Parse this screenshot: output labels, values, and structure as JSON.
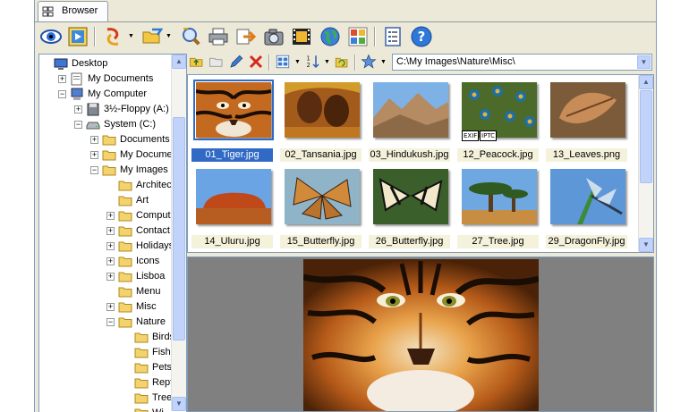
{
  "tab": {
    "label": "Browser"
  },
  "toolbar": {
    "buttons": [
      "view-icon",
      "slideshow-icon",
      "rotate-icon",
      "open-folder-icon",
      "find-icon",
      "print-icon",
      "send-icon",
      "camera-icon",
      "filmstrip-icon",
      "web-icon",
      "contact-sheet-icon",
      "properties-icon",
      "help-icon"
    ]
  },
  "tree": {
    "items": [
      {
        "label": "Desktop",
        "level": 0,
        "expander": "",
        "icon": "desktop"
      },
      {
        "label": "My Documents",
        "level": 1,
        "expander": "+",
        "icon": "documents"
      },
      {
        "label": "My Computer",
        "level": 1,
        "expander": "-",
        "icon": "computer"
      },
      {
        "label": "3½-Floppy (A:)",
        "level": 2,
        "expander": "+",
        "icon": "floppy"
      },
      {
        "label": "System (C:)",
        "level": 2,
        "expander": "-",
        "icon": "drive"
      },
      {
        "label": "Documents a",
        "level": 3,
        "expander": "+",
        "icon": "folder"
      },
      {
        "label": "My Documen",
        "level": 3,
        "expander": "+",
        "icon": "folder"
      },
      {
        "label": "My Images",
        "level": 3,
        "expander": "-",
        "icon": "folder"
      },
      {
        "label": "Architect",
        "level": 4,
        "expander": "",
        "icon": "folder"
      },
      {
        "label": "Art",
        "level": 4,
        "expander": "",
        "icon": "folder"
      },
      {
        "label": "Compute",
        "level": 4,
        "expander": "+",
        "icon": "folder"
      },
      {
        "label": "Contact",
        "level": 4,
        "expander": "+",
        "icon": "folder"
      },
      {
        "label": "Holidays",
        "level": 4,
        "expander": "+",
        "icon": "folder"
      },
      {
        "label": "Icons",
        "level": 4,
        "expander": "+",
        "icon": "folder"
      },
      {
        "label": "Lisboa",
        "level": 4,
        "expander": "+",
        "icon": "folder"
      },
      {
        "label": "Menu",
        "level": 4,
        "expander": "",
        "icon": "folder"
      },
      {
        "label": "Misc",
        "level": 4,
        "expander": "+",
        "icon": "folder"
      },
      {
        "label": "Nature",
        "level": 4,
        "expander": "-",
        "icon": "folder"
      },
      {
        "label": "Birds",
        "level": 5,
        "expander": "",
        "icon": "folder"
      },
      {
        "label": "Fish",
        "level": 5,
        "expander": "",
        "icon": "folder"
      },
      {
        "label": "Pets",
        "level": 5,
        "expander": "",
        "icon": "folder"
      },
      {
        "label": "Rept",
        "level": 5,
        "expander": "",
        "icon": "folder"
      },
      {
        "label": "Tree",
        "level": 5,
        "expander": "",
        "icon": "folder"
      },
      {
        "label": "Wi",
        "level": 5,
        "expander": "",
        "icon": "folder"
      }
    ]
  },
  "address": {
    "path": "C:\\My Images\\Nature\\Misc\\"
  },
  "addr_toolbar": [
    "up-folder-icon",
    "new-folder-icon",
    "rename-icon",
    "delete-icon",
    "view-mode-icon",
    "sort-icon",
    "refresh-icon",
    "favorites-icon"
  ],
  "thumbnails": [
    {
      "name": "01_Tiger.jpg",
      "selected": true,
      "art": "tiger",
      "badges": []
    },
    {
      "name": "02_Tansania.jpg",
      "selected": false,
      "art": "tansania",
      "badges": []
    },
    {
      "name": "03_Hindukush.jpg",
      "selected": false,
      "art": "mountain",
      "badges": []
    },
    {
      "name": "12_Peacock.jpg",
      "selected": false,
      "art": "peacock",
      "badges": [
        "EXIF",
        "IPTC"
      ]
    },
    {
      "name": "13_Leaves.png",
      "selected": false,
      "art": "leaves",
      "badges": []
    },
    {
      "name": "14_Uluru.jpg",
      "selected": false,
      "art": "uluru",
      "badges": []
    },
    {
      "name": "15_Butterfly.jpg",
      "selected": false,
      "art": "butterfly1",
      "badges": []
    },
    {
      "name": "26_Butterfly.jpg",
      "selected": false,
      "art": "butterfly2",
      "badges": []
    },
    {
      "name": "27_Tree.jpg",
      "selected": false,
      "art": "tree",
      "badges": []
    },
    {
      "name": "29_DragonFly.jpg",
      "selected": false,
      "art": "dragonfly",
      "badges": []
    }
  ],
  "colors": {
    "selection": "#316ac5",
    "caption_bg": "#f5f2dc",
    "window_bg": "#ece9d8",
    "border": "#7f9db9"
  }
}
